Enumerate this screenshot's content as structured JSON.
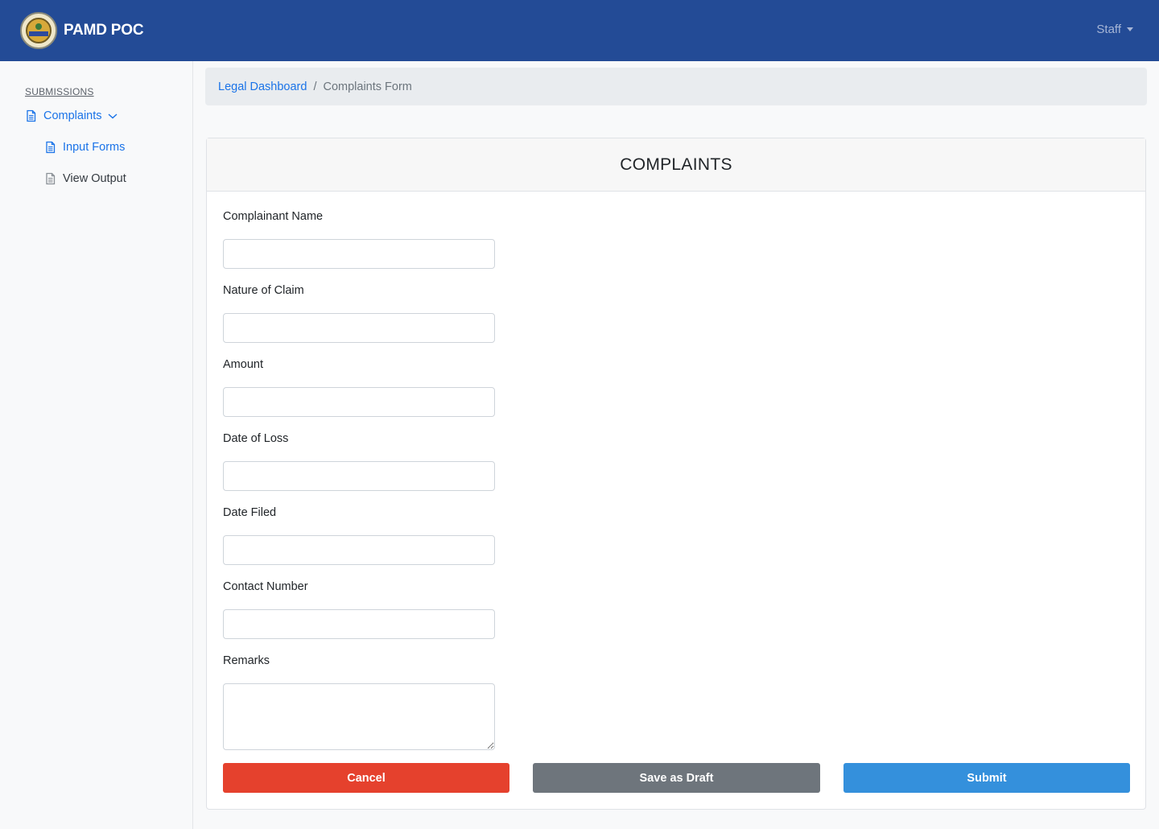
{
  "navbar": {
    "title": "PAMD POC",
    "user_menu": "Staff",
    "bg_color": "#234b96"
  },
  "sidebar": {
    "heading": "SUBMISSIONS",
    "items": [
      {
        "label": "Complaints",
        "icon": "document-icon",
        "expanded": true
      },
      {
        "label": "Input Forms",
        "icon": "document-icon"
      },
      {
        "label": "View Output",
        "icon": "document-icon"
      }
    ]
  },
  "breadcrumb": {
    "parent": "Legal Dashboard",
    "separator": "/",
    "current": "Complaints Form"
  },
  "form": {
    "title": "COMPLAINTS",
    "fields": [
      {
        "label": "Complainant Name",
        "value": ""
      },
      {
        "label": "Nature of Claim",
        "value": ""
      },
      {
        "label": "Amount",
        "value": ""
      },
      {
        "label": "Date of Loss",
        "value": ""
      },
      {
        "label": "Date Filed",
        "value": ""
      },
      {
        "label": "Contact Number",
        "value": ""
      },
      {
        "label": "Remarks",
        "value": ""
      }
    ],
    "buttons": {
      "cancel": "Cancel",
      "draft": "Save as Draft",
      "submit": "Submit"
    },
    "colors": {
      "cancel": "#e5412d",
      "draft": "#6e757c",
      "submit": "#3490dc"
    }
  }
}
